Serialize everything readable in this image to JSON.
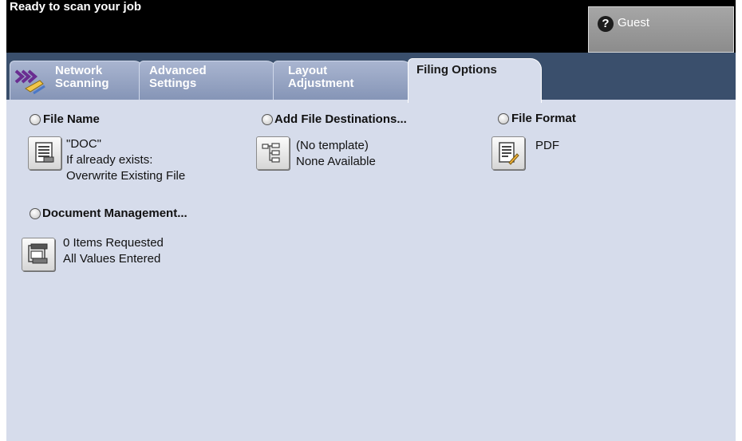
{
  "status": {
    "message": "Ready to scan your job"
  },
  "user": {
    "label": "Guest",
    "icon": "key-icon"
  },
  "tabs": [
    {
      "line1": "Network",
      "line2": "Scanning",
      "icon": "network-scanning-icon"
    },
    {
      "line1": "Advanced",
      "line2": "Settings"
    },
    {
      "line1": "Layout",
      "line2": "Adjustment"
    },
    {
      "line1": "Filing Options",
      "line2": "",
      "selected": true
    }
  ],
  "options": {
    "file_name": {
      "heading": "File Name",
      "icon": "file-name-icon",
      "value_lines": [
        "\"DOC\"",
        "If already exists:",
        "Overwrite Existing File"
      ]
    },
    "file_destinations": {
      "heading": "Add File Destinations...",
      "icon": "file-destinations-icon",
      "value_lines": [
        "(No template)",
        "None Available"
      ]
    },
    "file_format": {
      "heading": "File Format",
      "icon": "file-format-icon",
      "value_lines": [
        "PDF"
      ]
    },
    "document_management": {
      "heading": "Document Management...",
      "icon": "document-management-icon",
      "value_lines": [
        "0 Items Requested",
        "All Values Entered"
      ]
    }
  },
  "colors": {
    "panel": "#d6dceb",
    "tab_bar": "#3a4f6c",
    "tab_inactive": "#8393b5",
    "header": "#000000"
  }
}
